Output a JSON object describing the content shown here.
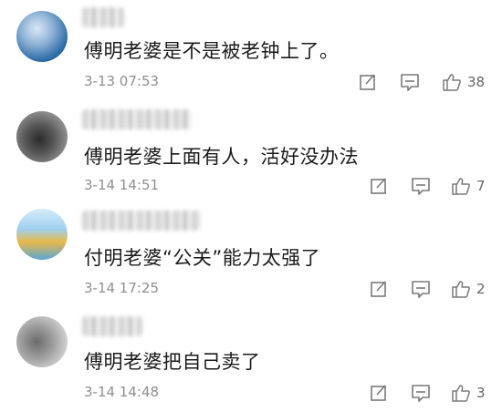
{
  "comments": [
    {
      "text": "傅明老婆是不是被老钟上了。",
      "time": "3-13 07:53",
      "likes": "38"
    },
    {
      "text": "傅明老婆上面有人，活好没办法",
      "time": "3-14 14:51",
      "likes": "7"
    },
    {
      "text": "付明老婆“公关”能力太强了",
      "time": "3-14 17:25",
      "likes": "2"
    },
    {
      "text": "傅明老婆把自己卖了",
      "time": "3-14 14:48",
      "likes": "3"
    }
  ],
  "icons": {
    "edit": "edit-icon",
    "reply": "comment-icon",
    "like": "thumbs-up-icon"
  },
  "colors": {
    "text": "#1b1b1b",
    "meta": "#8f8f8f",
    "icon": "#7a7a7a"
  }
}
